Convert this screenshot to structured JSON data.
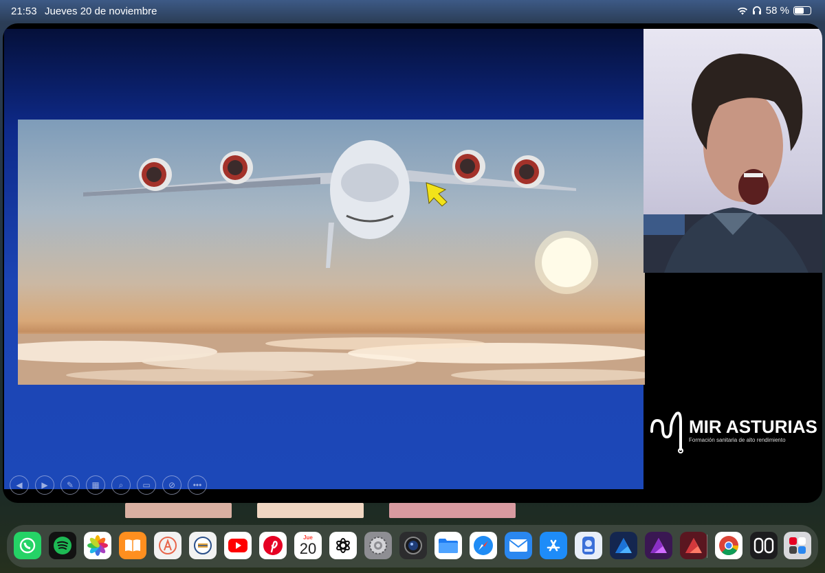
{
  "status_bar": {
    "time": "21:53",
    "date": "Jueves 20 de noviembre",
    "battery_text": "58 %",
    "battery_level": 0.58
  },
  "presentation": {
    "controls": [
      "previous",
      "next",
      "pen",
      "slides",
      "zoom",
      "subtitles",
      "camera-off",
      "more"
    ]
  },
  "logo": {
    "name": "MIR ASTURIAS",
    "tagline": "Formación sanitaria de alto rendimiento"
  },
  "calendar_icon": {
    "weekday": "Jue",
    "day": "20"
  },
  "dock": [
    {
      "name": "whatsapp",
      "color": "#25d366"
    },
    {
      "name": "spotify",
      "color": "#1db954"
    },
    {
      "name": "photos",
      "color": "#ffffff"
    },
    {
      "name": "books",
      "color": "#ff8f1f"
    },
    {
      "name": "affinity",
      "color": "#f2f2f2"
    },
    {
      "name": "badge-app",
      "color": "#f2f2f2"
    },
    {
      "name": "youtube",
      "color": "#ffffff"
    },
    {
      "name": "pinterest",
      "color": "#e60023"
    },
    {
      "name": "calendar",
      "color": "#ffffff"
    },
    {
      "name": "chatgpt",
      "color": "#ffffff"
    },
    {
      "name": "settings",
      "color": "#8e8e93"
    },
    {
      "name": "camera-app",
      "color": "#2c2c2e"
    },
    {
      "name": "files",
      "color": "#1e7cf2"
    },
    {
      "name": "safari",
      "color": "#1f8cf5"
    },
    {
      "name": "mail",
      "color": "#2a87f0"
    },
    {
      "name": "app-store",
      "color": "#1e8cf8"
    },
    {
      "name": "scanner",
      "color": "#3a6fd8"
    },
    {
      "name": "affinity-designer",
      "color": "#1f3a73"
    },
    {
      "name": "affinity-photo",
      "color": "#4b1f66"
    },
    {
      "name": "affinity-publisher",
      "color": "#7a1f2c"
    },
    {
      "name": "chrome",
      "color": "#ffffff"
    },
    {
      "name": "freeform",
      "color": "#1c1c1e"
    },
    {
      "name": "app-library",
      "color": "#d8d8dc"
    }
  ]
}
